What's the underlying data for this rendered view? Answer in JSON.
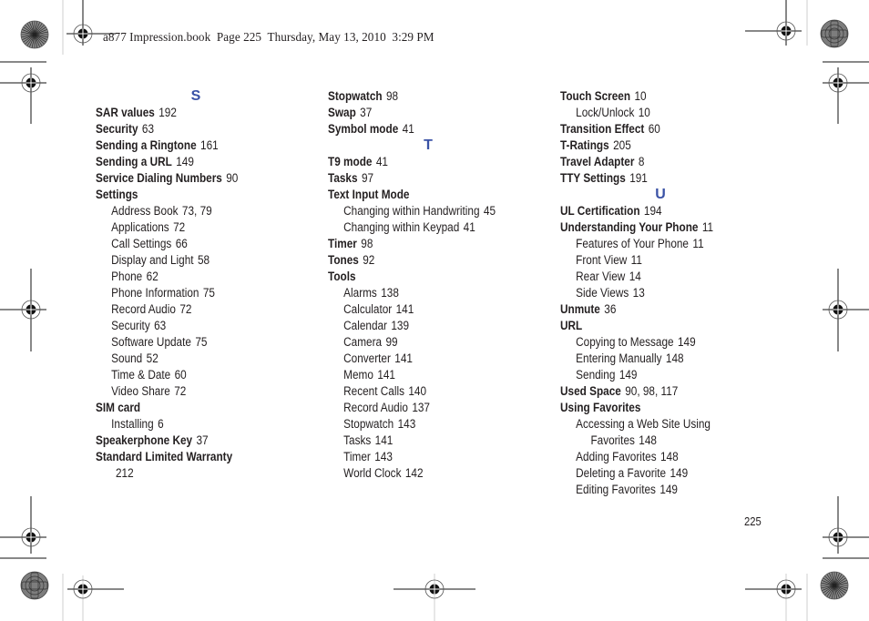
{
  "slug": "a877 Impression.book  Page 225  Thursday, May 13, 2010  3:29 PM",
  "page_number": "225",
  "colors": {
    "letter_heading": "#3a52a6",
    "text": "#231f20"
  },
  "icons": {
    "registration_mark": "crosshair-target-icon",
    "color_wheel": "starburst-registration-icon"
  },
  "columns": [
    {
      "entries": [
        {
          "kind": "letter",
          "text": "S"
        },
        {
          "kind": "head",
          "text": "SAR values",
          "pages": "192"
        },
        {
          "kind": "head",
          "text": "Security",
          "pages": "63"
        },
        {
          "kind": "head",
          "text": "Sending a Ringtone",
          "pages": "161"
        },
        {
          "kind": "head",
          "text": "Sending a URL",
          "pages": "149"
        },
        {
          "kind": "head",
          "text": "Service Dialing Numbers",
          "pages": "90"
        },
        {
          "kind": "head",
          "text": "Settings",
          "pages": ""
        },
        {
          "kind": "sub",
          "text": "Address Book",
          "pages": "73, 79"
        },
        {
          "kind": "sub",
          "text": "Applications",
          "pages": "72"
        },
        {
          "kind": "sub",
          "text": "Call Settings",
          "pages": "66"
        },
        {
          "kind": "sub",
          "text": "Display and Light",
          "pages": "58"
        },
        {
          "kind": "sub",
          "text": "Phone",
          "pages": "62"
        },
        {
          "kind": "sub",
          "text": "Phone Information",
          "pages": "75"
        },
        {
          "kind": "sub",
          "text": "Record Audio",
          "pages": "72"
        },
        {
          "kind": "sub",
          "text": "Security",
          "pages": "63"
        },
        {
          "kind": "sub",
          "text": "Software Update",
          "pages": "75"
        },
        {
          "kind": "sub",
          "text": "Sound",
          "pages": "52"
        },
        {
          "kind": "sub",
          "text": "Time & Date",
          "pages": "60"
        },
        {
          "kind": "sub",
          "text": "Video Share",
          "pages": "72"
        },
        {
          "kind": "head",
          "text": "SIM card",
          "pages": ""
        },
        {
          "kind": "sub",
          "text": "Installing",
          "pages": "6"
        },
        {
          "kind": "head",
          "text": "Speakerphone Key",
          "pages": "37"
        },
        {
          "kind": "head",
          "text": "Standard Limited Warranty",
          "pages": ""
        },
        {
          "kind": "cont",
          "text": "",
          "pages": "212"
        }
      ]
    },
    {
      "entries": [
        {
          "kind": "head",
          "text": "Stopwatch",
          "pages": "98"
        },
        {
          "kind": "head",
          "text": "Swap",
          "pages": "37"
        },
        {
          "kind": "head",
          "text": "Symbol mode",
          "pages": "41"
        },
        {
          "kind": "letter",
          "text": "T"
        },
        {
          "kind": "head",
          "text": "T9 mode",
          "pages": "41"
        },
        {
          "kind": "head",
          "text": "Tasks",
          "pages": "97"
        },
        {
          "kind": "head",
          "text": "Text Input Mode",
          "pages": ""
        },
        {
          "kind": "sub",
          "text": "Changing within Handwriting",
          "pages": "45"
        },
        {
          "kind": "sub",
          "text": "Changing within Keypad",
          "pages": "41"
        },
        {
          "kind": "head",
          "text": "Timer",
          "pages": "98"
        },
        {
          "kind": "head",
          "text": "Tones",
          "pages": "92"
        },
        {
          "kind": "head",
          "text": "Tools",
          "pages": ""
        },
        {
          "kind": "sub",
          "text": "Alarms",
          "pages": "138"
        },
        {
          "kind": "sub",
          "text": "Calculator",
          "pages": "141"
        },
        {
          "kind": "sub",
          "text": "Calendar",
          "pages": "139"
        },
        {
          "kind": "sub",
          "text": "Camera",
          "pages": "99"
        },
        {
          "kind": "sub",
          "text": "Converter",
          "pages": "141"
        },
        {
          "kind": "sub",
          "text": "Memo",
          "pages": "141"
        },
        {
          "kind": "sub",
          "text": "Recent Calls",
          "pages": "140"
        },
        {
          "kind": "sub",
          "text": "Record Audio",
          "pages": "137"
        },
        {
          "kind": "sub",
          "text": "Stopwatch",
          "pages": "143"
        },
        {
          "kind": "sub",
          "text": "Tasks",
          "pages": "141"
        },
        {
          "kind": "sub",
          "text": "Timer",
          "pages": "143"
        },
        {
          "kind": "sub",
          "text": "World Clock",
          "pages": "142"
        }
      ]
    },
    {
      "entries": [
        {
          "kind": "head",
          "text": "Touch Screen",
          "pages": "10"
        },
        {
          "kind": "sub",
          "text": "Lock/Unlock",
          "pages": "10"
        },
        {
          "kind": "head",
          "text": "Transition Effect",
          "pages": "60"
        },
        {
          "kind": "head",
          "text": "T-Ratings",
          "pages": "205"
        },
        {
          "kind": "head",
          "text": "Travel Adapter",
          "pages": "8"
        },
        {
          "kind": "head",
          "text": "TTY Settings",
          "pages": "191"
        },
        {
          "kind": "letter",
          "text": "U"
        },
        {
          "kind": "head",
          "text": "UL Certification",
          "pages": "194"
        },
        {
          "kind": "head",
          "text": "Understanding Your Phone",
          "pages": "11"
        },
        {
          "kind": "sub",
          "text": "Features of Your Phone",
          "pages": "11"
        },
        {
          "kind": "sub",
          "text": "Front View",
          "pages": "11"
        },
        {
          "kind": "sub",
          "text": "Rear View",
          "pages": "14"
        },
        {
          "kind": "sub",
          "text": "Side Views",
          "pages": "13"
        },
        {
          "kind": "head",
          "text": "Unmute",
          "pages": "36"
        },
        {
          "kind": "head",
          "text": "URL",
          "pages": ""
        },
        {
          "kind": "sub",
          "text": "Copying to Message",
          "pages": "149"
        },
        {
          "kind": "sub",
          "text": "Entering Manually",
          "pages": "148"
        },
        {
          "kind": "sub",
          "text": "Sending",
          "pages": "149"
        },
        {
          "kind": "head",
          "text": "Used Space",
          "pages": "90, 98, 117"
        },
        {
          "kind": "head",
          "text": "Using Favorites",
          "pages": ""
        },
        {
          "kind": "sub",
          "text": "Accessing a Web Site Using",
          "pages": ""
        },
        {
          "kind": "sub2",
          "text": "Favorites",
          "pages": "148"
        },
        {
          "kind": "sub",
          "text": "Adding Favorites",
          "pages": "148"
        },
        {
          "kind": "sub",
          "text": "Deleting a Favorite",
          "pages": "149"
        },
        {
          "kind": "sub",
          "text": "Editing Favorites",
          "pages": "149"
        }
      ]
    }
  ]
}
